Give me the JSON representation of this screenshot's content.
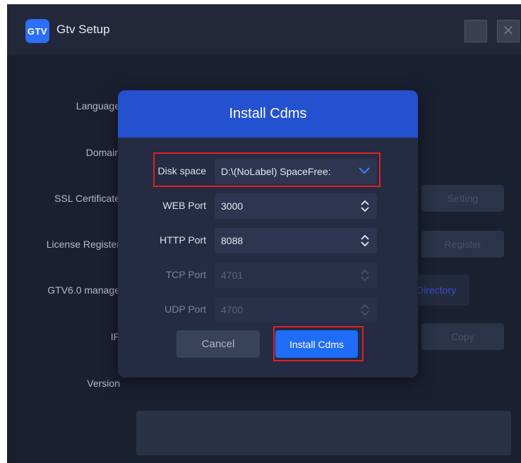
{
  "window": {
    "logo_text": "GTV",
    "title": "Gtv Setup",
    "close_glyph": "✕"
  },
  "form": {
    "labels": [
      "Language",
      "Domain",
      "SSL Certificate",
      "License Register",
      "GTV6.0 manage",
      "IP",
      "Version"
    ],
    "setting_label": "Setting",
    "register_label": "Register",
    "directory_label": "Directory",
    "copy_label": "Copy"
  },
  "modal": {
    "title": "Install Cdms",
    "disk_label": "Disk space",
    "disk_value": "D:\\(NoLabel)  SpaceFree:",
    "web_label": "WEB Port",
    "web_value": "3000",
    "http_label": "HTTP Port",
    "http_value": "8088",
    "tcp_label": "TCP Port",
    "tcp_value": "4701",
    "udp_label": "UDP Port",
    "udp_value": "4700",
    "cancel_label": "Cancel",
    "install_label": "Install Cdms"
  },
  "colors": {
    "accent": "#1f6cf6",
    "header": "#2451cf",
    "highlight": "#e02024"
  },
  "icons": [
    "chevron-down-icon",
    "stepper-icon",
    "close-icon",
    "minimize-icon"
  ]
}
